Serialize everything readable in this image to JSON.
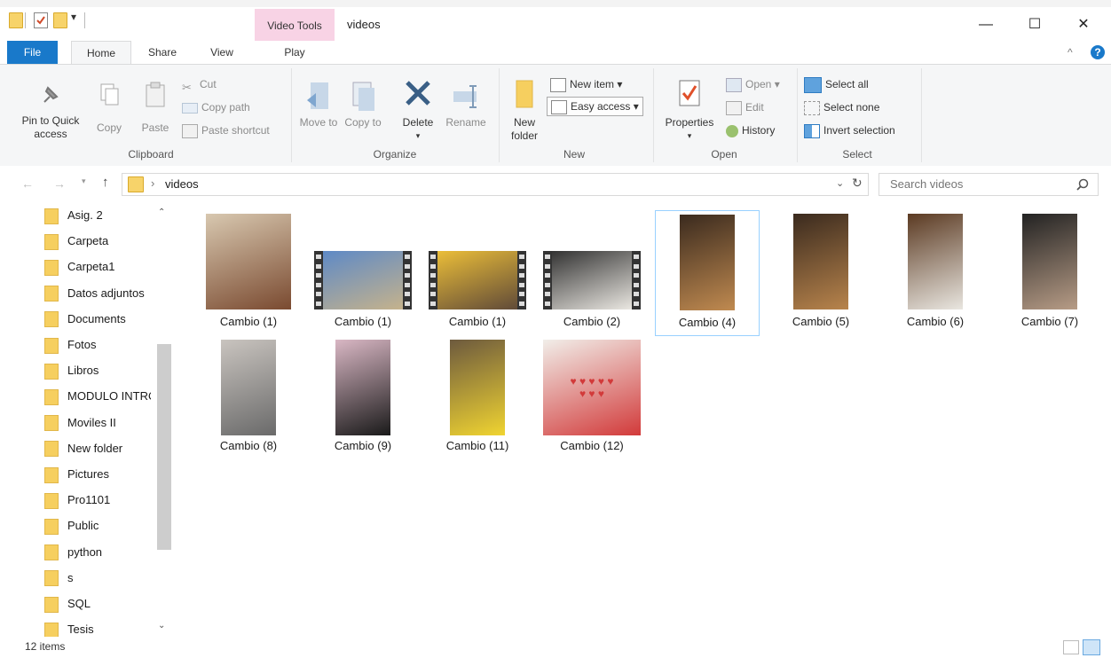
{
  "window": {
    "title": "videos",
    "context_tab": "Video Tools",
    "minimize": "—",
    "maximize": "☐",
    "close": "✕"
  },
  "tabs": {
    "file": "File",
    "home": "Home",
    "share": "Share",
    "view": "View",
    "play": "Play"
  },
  "ribbon": {
    "clipboard": {
      "pin": "Pin to Quick access",
      "copy": "Copy",
      "paste": "Paste",
      "cut": "Cut",
      "copy_path": "Copy path",
      "paste_shortcut": "Paste shortcut",
      "group": "Clipboard"
    },
    "organize": {
      "move_to": "Move to",
      "copy_to": "Copy to",
      "delete": "Delete",
      "rename": "Rename",
      "group": "Organize"
    },
    "new": {
      "new_folder": "New folder",
      "new_item": "New item",
      "easy_access": "Easy access",
      "group": "New"
    },
    "open": {
      "properties": "Properties",
      "open": "Open",
      "edit": "Edit",
      "history": "History",
      "group": "Open"
    },
    "select": {
      "select_all": "Select all",
      "select_none": "Select none",
      "invert_selection": "Invert selection",
      "group": "Select"
    }
  },
  "address": {
    "path": "videos",
    "search_placeholder": "Search videos"
  },
  "sidebar": {
    "items": [
      "Asig. 2",
      "Carpeta",
      "Carpeta1",
      "Datos adjuntos",
      "Documents",
      "Fotos",
      "Libros",
      "MODULO INTRO",
      "Moviles II",
      "New folder",
      "Pictures",
      "Pro1101",
      "Public",
      "python",
      "s",
      "SQL",
      "Tesis"
    ]
  },
  "files": [
    {
      "name": "Cambio (1)",
      "kind": "poster"
    },
    {
      "name": "Cambio (1)",
      "kind": "video"
    },
    {
      "name": "Cambio (1)",
      "kind": "video"
    },
    {
      "name": "Cambio (2)",
      "kind": "video"
    },
    {
      "name": "Cambio (4)",
      "kind": "portrait",
      "selected": true
    },
    {
      "name": "Cambio (5)",
      "kind": "portrait"
    },
    {
      "name": "Cambio (6)",
      "kind": "portrait"
    },
    {
      "name": "Cambio (7)",
      "kind": "portrait"
    },
    {
      "name": "Cambio (8)",
      "kind": "portrait"
    },
    {
      "name": "Cambio (9)",
      "kind": "portrait"
    },
    {
      "name": "Cambio (11)",
      "kind": "portrait"
    },
    {
      "name": "Cambio (12)",
      "kind": "card"
    }
  ],
  "status": {
    "count": "12 items"
  },
  "colors": {
    "accent": "#1979ca",
    "video_tools": "#f8d3e5",
    "selection": "#99d1ff"
  }
}
